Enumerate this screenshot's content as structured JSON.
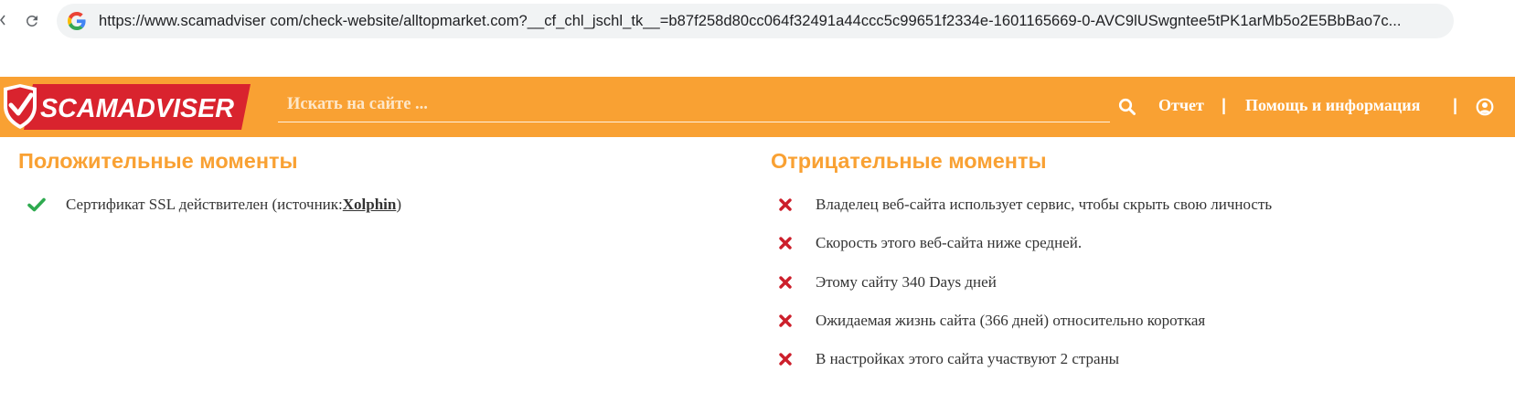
{
  "browser": {
    "url": "https://www.scamadviser com/check-website/alltopmarket.com?__cf_chl_jschl_tk__=b87f258d80cc064f32491a44ccc5c99651f2334e-1601165669-0-AVC9lUSwgntee5tPK1arMb5o2E5BbBao7c..."
  },
  "header": {
    "logo_text": "SCAMADVISER",
    "search_placeholder": "Искать на сайте ...",
    "nav": {
      "report": "Отчет",
      "separator": "|",
      "help": "Помощь и информация"
    }
  },
  "positive": {
    "title": "Положительные моменты",
    "items": [
      {
        "text_before": "Сертификат SSL действителен (источник: ",
        "link": "Xolphin",
        "text_after": " )"
      }
    ]
  },
  "negative": {
    "title": "Отрицательные моменты",
    "items": [
      "Владелец веб-сайта использует сервис, чтобы скрыть свою личность",
      "Скорость этого веб-сайта ниже средней.",
      "Этому сайту 340 Days дней",
      "Ожидаемая жизнь сайта (366 дней) относительно короткая",
      "В настройках этого сайта участвуют 2 страны"
    ]
  },
  "colors": {
    "brand_orange": "#f9a133",
    "logo_red": "#d9232e",
    "positive_green": "#2eaa4f",
    "negative_red": "#cc1f2b",
    "text": "#333333"
  },
  "icons": {
    "reload": "reload-icon",
    "google": "google-g-icon",
    "search": "search-icon",
    "user": "user-icon",
    "positive": "check-icon",
    "negative": "cross-icon"
  }
}
